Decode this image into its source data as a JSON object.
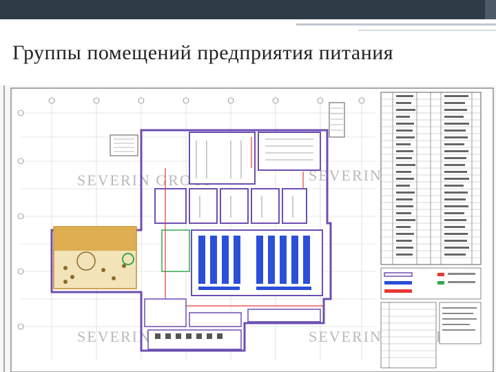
{
  "slide": {
    "title": "Группы помещений предприятия питания"
  },
  "plan": {
    "watermark": "SEVERIN GROUP",
    "colors": {
      "outline": "#6b4fb0",
      "partition": "#8c7ad1",
      "equipment": "#2b4fd8",
      "dining": "#d9a441",
      "red": "#e53935",
      "green": "#2fa84f",
      "grid": "#c9c9c9",
      "ink": "#333333"
    }
  }
}
